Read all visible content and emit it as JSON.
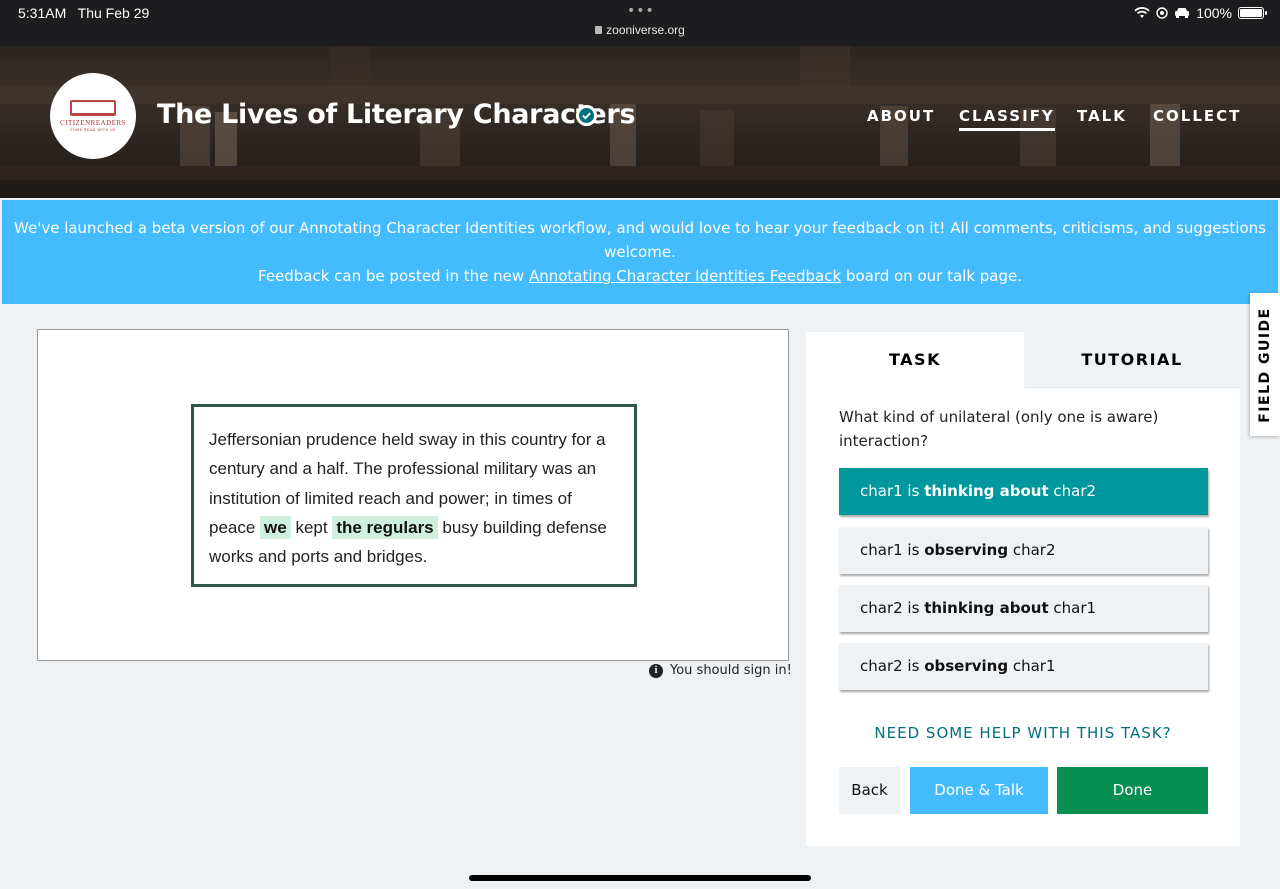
{
  "statusbar": {
    "time": "5:31AM",
    "date": "Thu Feb 29",
    "dots": "•••",
    "url": "zooniverse.org",
    "battery": "100%",
    "icons": [
      "wifi-icon",
      "location-icon",
      "car-icon",
      "battery-icon"
    ]
  },
  "header": {
    "logo_name": "CITIZENREADERS",
    "logo_tagline": "COME READ WITH US",
    "title": "The Lives of Literary Characters",
    "nav": {
      "about": "ABOUT",
      "classify": "CLASSIFY",
      "talk": "TALK",
      "collect": "COLLECT"
    }
  },
  "banner": {
    "line1": "We've launched a beta version of our Annotating Character Identities workflow, and would love to hear your feedback on it! All comments, criticisms, and suggestions welcome.",
    "line2_before": "Feedback can be posted in the new ",
    "line2_link": "Annotating Character Identities Feedback",
    "line2_after": " board on our talk page."
  },
  "subject": {
    "text_1": "Jeffersonian prudence held sway in this country for a century and a half. The professional military was an institution of limited reach and power; in times of peace ",
    "highlight_1": "we",
    "text_2": " kept ",
    "highlight_2": "the regulars",
    "text_3": " busy building defense works and ports and bridges.",
    "signin": "You should sign in!"
  },
  "task": {
    "tab_task": "TASK",
    "tab_tutorial": "TUTORIAL",
    "question": "What kind of unilateral (only one is aware) interaction?",
    "options": [
      {
        "pre": "char1 is ",
        "bold": "thinking about",
        "post": " char2"
      },
      {
        "pre": "char1 is ",
        "bold": "observing",
        "post": " char2"
      },
      {
        "pre": "char2 is ",
        "bold": "thinking about",
        "post": " char1"
      },
      {
        "pre": "char2 is ",
        "bold": "observing",
        "post": " char1"
      }
    ],
    "help": "NEED SOME HELP WITH THIS TASK?",
    "back": "Back",
    "done_talk": "Done & Talk",
    "done": "Done"
  },
  "field_guide": "FIELD GUIDE",
  "colors": {
    "banner": "#43bbfd",
    "selected_option": "#00979d",
    "done": "#078f52",
    "highlight": "#cfefdf",
    "help": "#00717a"
  }
}
